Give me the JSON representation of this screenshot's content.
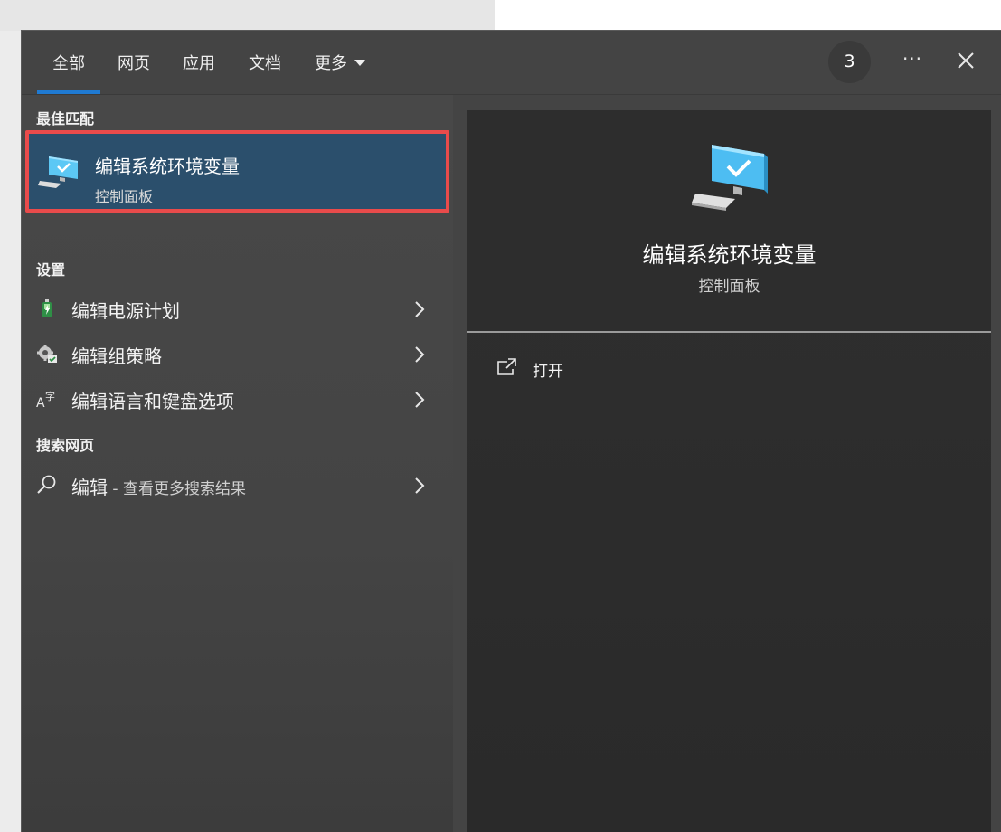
{
  "tabs": [
    {
      "label": "全部",
      "active": true
    },
    {
      "label": "网页"
    },
    {
      "label": "应用"
    },
    {
      "label": "文档"
    },
    {
      "label": "更多"
    }
  ],
  "header": {
    "count": "3",
    "more_label": "···"
  },
  "best_match": {
    "section_title": "最佳匹配",
    "name": "编辑系统环境变量",
    "subtitle": "控制面板"
  },
  "settings": {
    "section_title": "设置",
    "items": [
      {
        "label": "编辑电源计划",
        "icon": "battery-icon"
      },
      {
        "label": "编辑组策略",
        "icon": "group-policy-icon"
      },
      {
        "label": "编辑语言和键盘选项",
        "icon": "language-icon"
      }
    ]
  },
  "web": {
    "section_title": "搜索网页",
    "query": "编辑",
    "hint": " - 查看更多搜索结果"
  },
  "preview": {
    "name": "编辑系统环境变量",
    "subtitle": "控制面板",
    "actions": [
      {
        "label": "打开",
        "icon": "open-external-icon"
      }
    ]
  },
  "colors": {
    "accent": "#1f7ad2",
    "highlight_border": "#e94b4b",
    "selected_bg": "#2b4f6c"
  }
}
